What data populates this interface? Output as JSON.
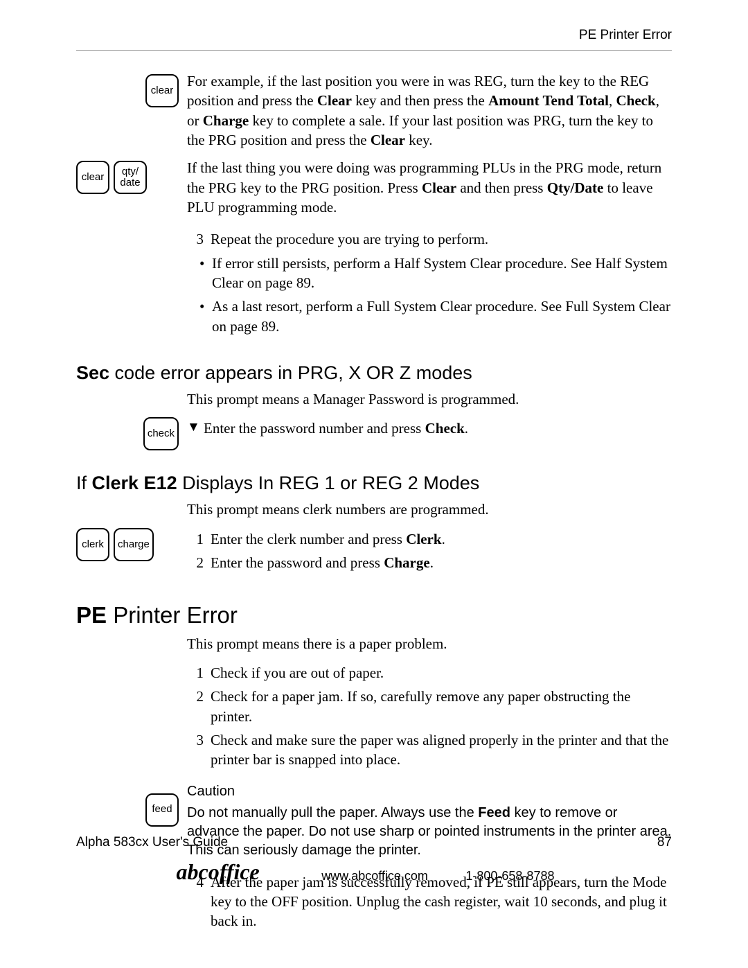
{
  "header": {
    "right": "PE Printer Error"
  },
  "keys": {
    "clear": "clear",
    "qtydate": "qty/\ndate",
    "check": "check",
    "clerk": "clerk",
    "charge": "charge",
    "feed": "feed"
  },
  "s1": {
    "example_pre": "For example, if the last position you were in was REG, turn the key to the REG position and press the ",
    "k_clear": "Clear",
    "example_mid1": " key and then press the ",
    "k_amt": "Amount Tend Total",
    "comma1": ", ",
    "k_check": "Check",
    "comma2": ", or ",
    "k_charge": "Charge",
    "example_mid2": " key to complete a sale. If your last position was PRG, turn the key to the PRG position and press the ",
    "example_end": " key.",
    "plu_pre": "If the last thing you were doing was programming PLUs in the PRG mode, return the PRG key to the PRG position. Press ",
    "plu_mid": " and then press ",
    "k_qtydate": "Qty/Date",
    "plu_end": " to leave PLU programming mode.",
    "step3_num": "3",
    "step3": "Repeat the procedure you are trying to perform.",
    "b1": "If error still persists, perform a Half System Clear procedure. See Half System Clear on page 89.",
    "b2": "As a last resort, perform a Full System Clear procedure. See Full System Clear on page 89."
  },
  "sec": {
    "head_pre": "Sec",
    "head_post": " code error appears in PRG, X OR Z modes",
    "intro": "This prompt means a Manager Password is programmed.",
    "arrow": "▼",
    "line_pre": "Enter the password number and press ",
    "k_check": "Check",
    "dot": "."
  },
  "clerk": {
    "head_pre": "If ",
    "head_bold": "Clerk E12",
    "head_post": " Displays In REG 1 or REG 2 Modes",
    "intro": "This prompt means clerk numbers are programmed.",
    "n1": "1",
    "l1_pre": "Enter the clerk number and press ",
    "k_clerk": "Clerk",
    "n2": "2",
    "l2_pre": "Enter the password and press ",
    "k_charge": "Charge",
    "dot": "."
  },
  "pe": {
    "head_pre": "PE",
    "head_post": " Printer Error",
    "intro": "This prompt means there is a paper problem.",
    "n1": "1",
    "l1": "Check if you are out of paper.",
    "n2": "2",
    "l2": "Check for a paper jam. If so, carefully remove any paper obstructing the printer.",
    "n3": "3",
    "l3": "Check and make sure the paper was aligned properly in the printer and that the printer bar is snapped into place.",
    "caution_head": "Caution",
    "caution_pre": "Do not manually pull the paper. Always use the ",
    "k_feed": "Feed",
    "caution_post": " key to remove or advance the paper. Do not use sharp or pointed instruments in the printer area. This can seriously damage the printer.",
    "n4": "4",
    "l4": "After the paper jam is successfully removed, if PE still appears, turn the Mode key to the OFF position. Unplug the cash register, wait 10 seconds, and plug it back in."
  },
  "footer": {
    "left": "Alpha 583cx  User's Guide",
    "right": "87"
  },
  "brand": {
    "name": "abcoffice",
    "url": "www.abcoffice.com",
    "phone": "1-800-658-8788"
  }
}
